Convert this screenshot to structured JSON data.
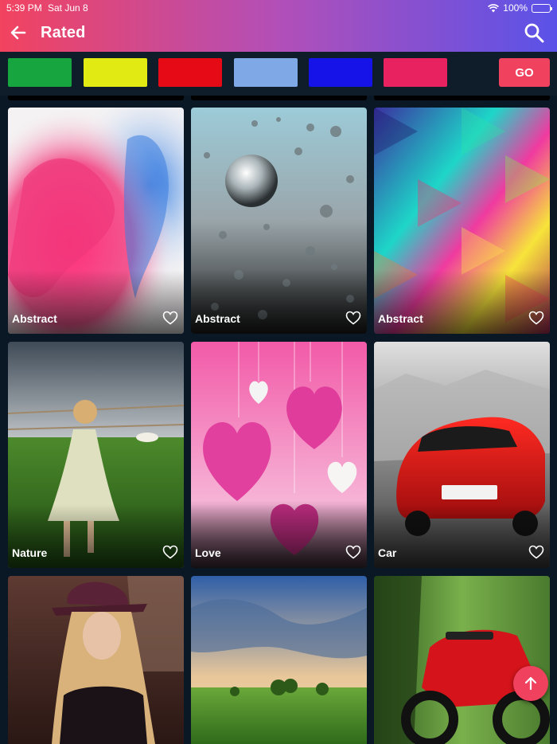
{
  "status_bar": {
    "time": "5:39 PM",
    "date": "Sat Jun 8",
    "battery": "100%"
  },
  "header": {
    "title": "Rated",
    "back_icon": "arrow-left-icon",
    "search_icon": "search-icon"
  },
  "color_filter": {
    "swatches": [
      "#17a540",
      "#e2ea13",
      "#e60a17",
      "#7ea8e6",
      "#1513e8",
      "#e82260"
    ],
    "go_label": "GO",
    "go_color": "#f0425f"
  },
  "wallpapers": [
    {
      "category": "Abstract"
    },
    {
      "category": "Abstract"
    },
    {
      "category": "Abstract"
    },
    {
      "category": "Nature"
    },
    {
      "category": "Love"
    },
    {
      "category": "Car"
    },
    {
      "category": ""
    },
    {
      "category": ""
    },
    {
      "category": ""
    }
  ],
  "fab": {
    "icon": "arrow-up-icon"
  },
  "colors": {
    "header_start": "#f2435f",
    "header_end": "#5a52e8",
    "background": "#0a1826"
  }
}
